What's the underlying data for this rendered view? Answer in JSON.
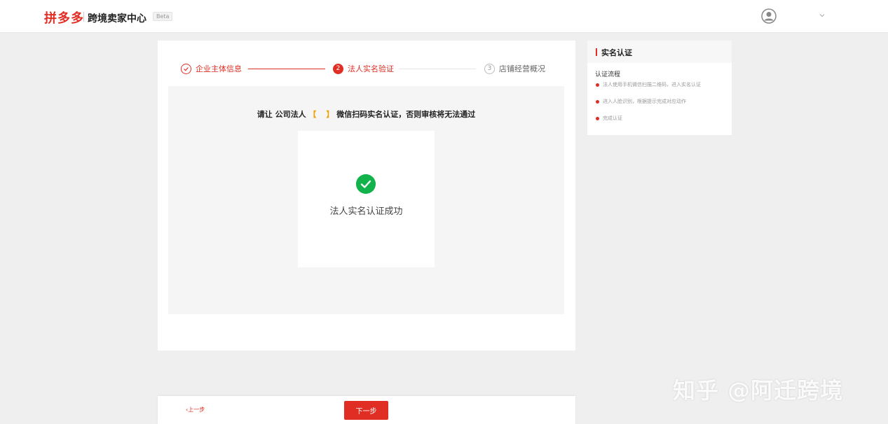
{
  "header": {
    "logo": "拼多多",
    "product": "跨境卖家中心",
    "beta": "Beta"
  },
  "steps": [
    {
      "num": "",
      "label": "企业主体信息",
      "state": "done"
    },
    {
      "num": "2",
      "label": "法人实名验证",
      "state": "active"
    },
    {
      "num": "3",
      "label": "店铺经营概况",
      "state": "pending"
    }
  ],
  "main": {
    "instruction_prefix": "请让 公司法人",
    "bracket_open": "【",
    "bracket_close": "】",
    "instruction_suffix": "微信扫码实名认证，否则审核将无法通过",
    "success_text": "法人实名认证成功"
  },
  "side": {
    "title": "实名认证",
    "subtitle": "认证流程",
    "items": [
      "法人使用手机微信扫描二维码，进入实名认证",
      "进入人脸识别，根据提示完成对应动作",
      "完成认证"
    ]
  },
  "footer": {
    "prev_label": "上一步",
    "next_label": "下一步"
  },
  "watermark": "知乎 @阿迁跨境",
  "colors": {
    "brand": "#e02e24",
    "success": "#11b34a",
    "bracket": "#f0a202"
  }
}
